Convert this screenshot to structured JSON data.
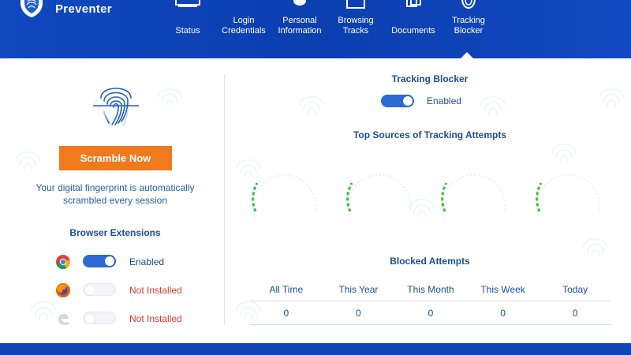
{
  "app": {
    "brand": "Preventer"
  },
  "nav": {
    "items": [
      {
        "label": "Status",
        "icon": "monitor-icon"
      },
      {
        "label": "Login\nCredentials",
        "icon": "key-icon"
      },
      {
        "label": "Personal\nInformation",
        "icon": "person-icon"
      },
      {
        "label": "Browsing\nTracks",
        "icon": "browser-icon"
      },
      {
        "label": "Documents",
        "icon": "documents-icon"
      },
      {
        "label": "Tracking\nBlocker",
        "icon": "tracking-icon",
        "active": true
      }
    ]
  },
  "left": {
    "scramble_button": "Scramble Now",
    "fingerprint_note": "Your digital fingerprint is automatically scrambled every session",
    "extensions_title": "Browser Extensions",
    "extensions": [
      {
        "browser": "chrome-icon",
        "enabled": true,
        "status": "Enabled"
      },
      {
        "browser": "firefox-icon",
        "enabled": false,
        "status": "Not Installed"
      },
      {
        "browser": "edge-icon",
        "enabled": false,
        "status": "Not Installed"
      }
    ]
  },
  "right": {
    "tracking_blocker_title": "Tracking Blocker",
    "tracking_blocker_enabled": true,
    "tracking_blocker_status": "Enabled",
    "top_sources_title": "Top Sources of Tracking Attempts",
    "blocked_title": "Blocked Attempts",
    "blocked_headers": [
      "All Time",
      "This Year",
      "This Month",
      "This Week",
      "Today"
    ],
    "blocked_values": [
      "0",
      "0",
      "0",
      "0",
      "0"
    ]
  },
  "colors": {
    "brand_blue": "#0f47b8",
    "accent_orange": "#f07a1d",
    "text_blue": "#1b4f8f",
    "toggle_on": "#2b6ad3",
    "error_red": "#e23a2d",
    "gauge_green": "#3cbf3a"
  }
}
